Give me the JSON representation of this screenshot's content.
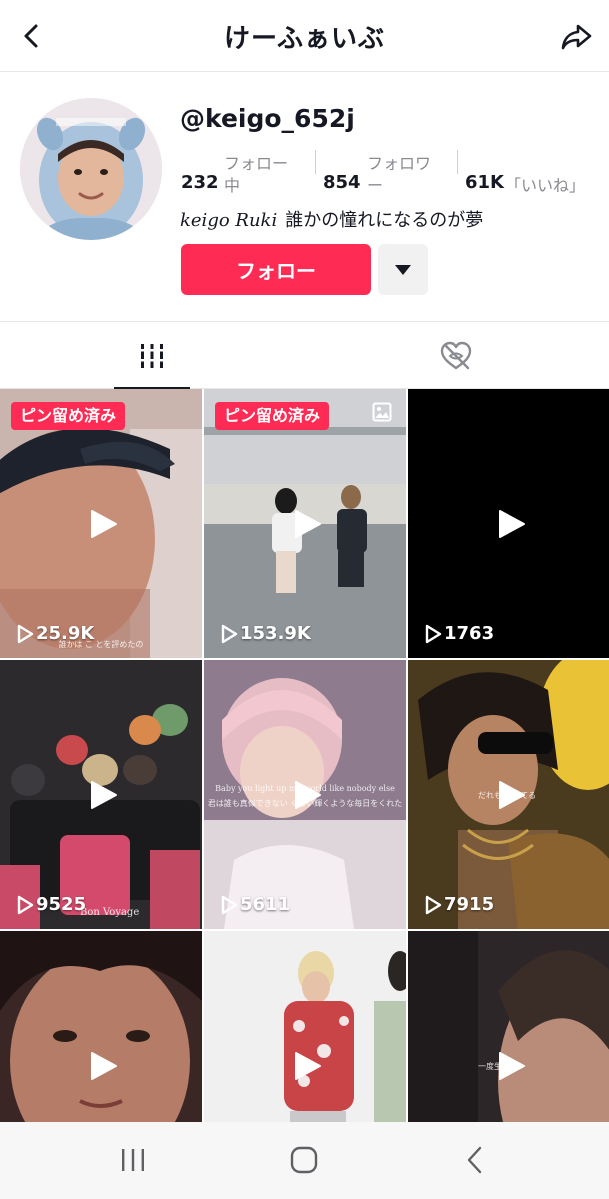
{
  "header": {
    "title": "けーふぁいぶ",
    "back_icon": "chevron-left-icon",
    "share_icon": "share-arrow-icon"
  },
  "profile": {
    "username": "@keigo_652j",
    "stats": [
      {
        "label": "フォロー",
        "value": "232",
        "suffix": "中"
      },
      {
        "label": "フォロワ",
        "value": "854",
        "suffix": "ー"
      },
      {
        "label": "",
        "value": "61K",
        "suffix": "「いいね」"
      }
    ],
    "bio_signature": "keigo Ruki",
    "bio_text": "誰かの憧れになるのが夢",
    "follow_label": "フォロー",
    "more_icon": "caret-down-icon"
  },
  "tabs": [
    {
      "name": "videos",
      "icon": "grid-bars-icon",
      "selected": true
    },
    {
      "name": "liked",
      "icon": "heart-hidden-icon",
      "selected": false
    }
  ],
  "videos": [
    {
      "views": "25.9K",
      "pinned": true,
      "pin_label": "ピン留め済み",
      "caption": "誰かは こ とを評めたの"
    },
    {
      "views": "153.9K",
      "pinned": true,
      "pin_label": "ピン留め済み",
      "photo": true
    },
    {
      "views": "1763",
      "pinned": false
    },
    {
      "views": "9525",
      "pinned": false,
      "caption": "Bon Voyage"
    },
    {
      "views": "5611",
      "pinned": false,
      "caption": "Baby you light up my world like nobody else",
      "caption2": "君は誰も真似できない くらい輝くような毎日をくれた"
    },
    {
      "views": "7915",
      "pinned": false,
      "caption": "だれもが ってる"
    },
    {
      "views": "",
      "pinned": false
    },
    {
      "views": "",
      "pinned": false
    },
    {
      "views": "",
      "pinned": false,
      "caption": "一度生 たら"
    }
  ],
  "navbar": {
    "recent_icon": "recent-apps-icon",
    "home_icon": "home-circle-icon",
    "back_icon": "nav-back-icon"
  },
  "colors": {
    "accent": "#fe2c55",
    "text": "#161823",
    "muted": "#8a8b91"
  }
}
